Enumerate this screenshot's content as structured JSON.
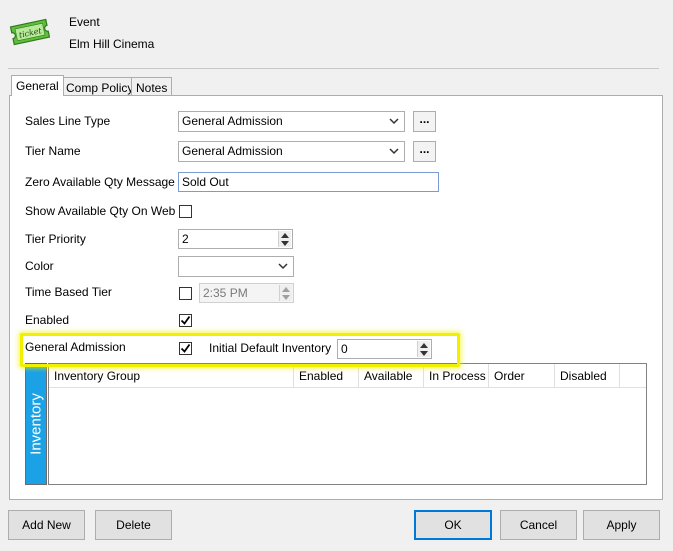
{
  "header": {
    "title": "Event",
    "subtitle": "Elm Hill Cinema",
    "icon": "ticket-icon",
    "icon_text": "ticket"
  },
  "tabs": [
    {
      "label": "General",
      "active": true
    },
    {
      "label": "Comp Policy",
      "active": false
    },
    {
      "label": "Notes",
      "active": false
    }
  ],
  "form": {
    "sales_line_type": {
      "label": "Sales Line Type",
      "value": "General Admission",
      "browse_label": "..."
    },
    "tier_name": {
      "label": "Tier Name",
      "value": "General Admission",
      "browse_label": "..."
    },
    "zero_available_msg": {
      "label": "Zero Available Qty Message",
      "value": "Sold Out"
    },
    "show_available_qty": {
      "label": "Show Available Qty On Web",
      "checked": false
    },
    "tier_priority": {
      "label": "Tier Priority",
      "value": "2"
    },
    "color": {
      "label": "Color",
      "value": ""
    },
    "time_based_tier": {
      "label": "Time Based Tier",
      "checked": false,
      "time": "2:35 PM"
    },
    "enabled": {
      "label": "Enabled",
      "checked": true
    },
    "general_admission": {
      "label": "General Admission",
      "checked": true
    },
    "initial_default_inventory": {
      "label": "Initial Default Inventory",
      "value": "0"
    }
  },
  "inventory": {
    "side_label": "Inventory",
    "columns": [
      "Inventory Group",
      "Enabled",
      "Available",
      "In Process",
      "Order",
      "Disabled"
    ],
    "rows": []
  },
  "buttons": {
    "add_new": "Add New",
    "delete": "Delete",
    "ok": "OK",
    "cancel": "Cancel",
    "apply": "Apply"
  },
  "colors": {
    "inventory_accent": "#1aa1e6",
    "highlight": "#f0f000",
    "focus_border": "#0078d7"
  }
}
